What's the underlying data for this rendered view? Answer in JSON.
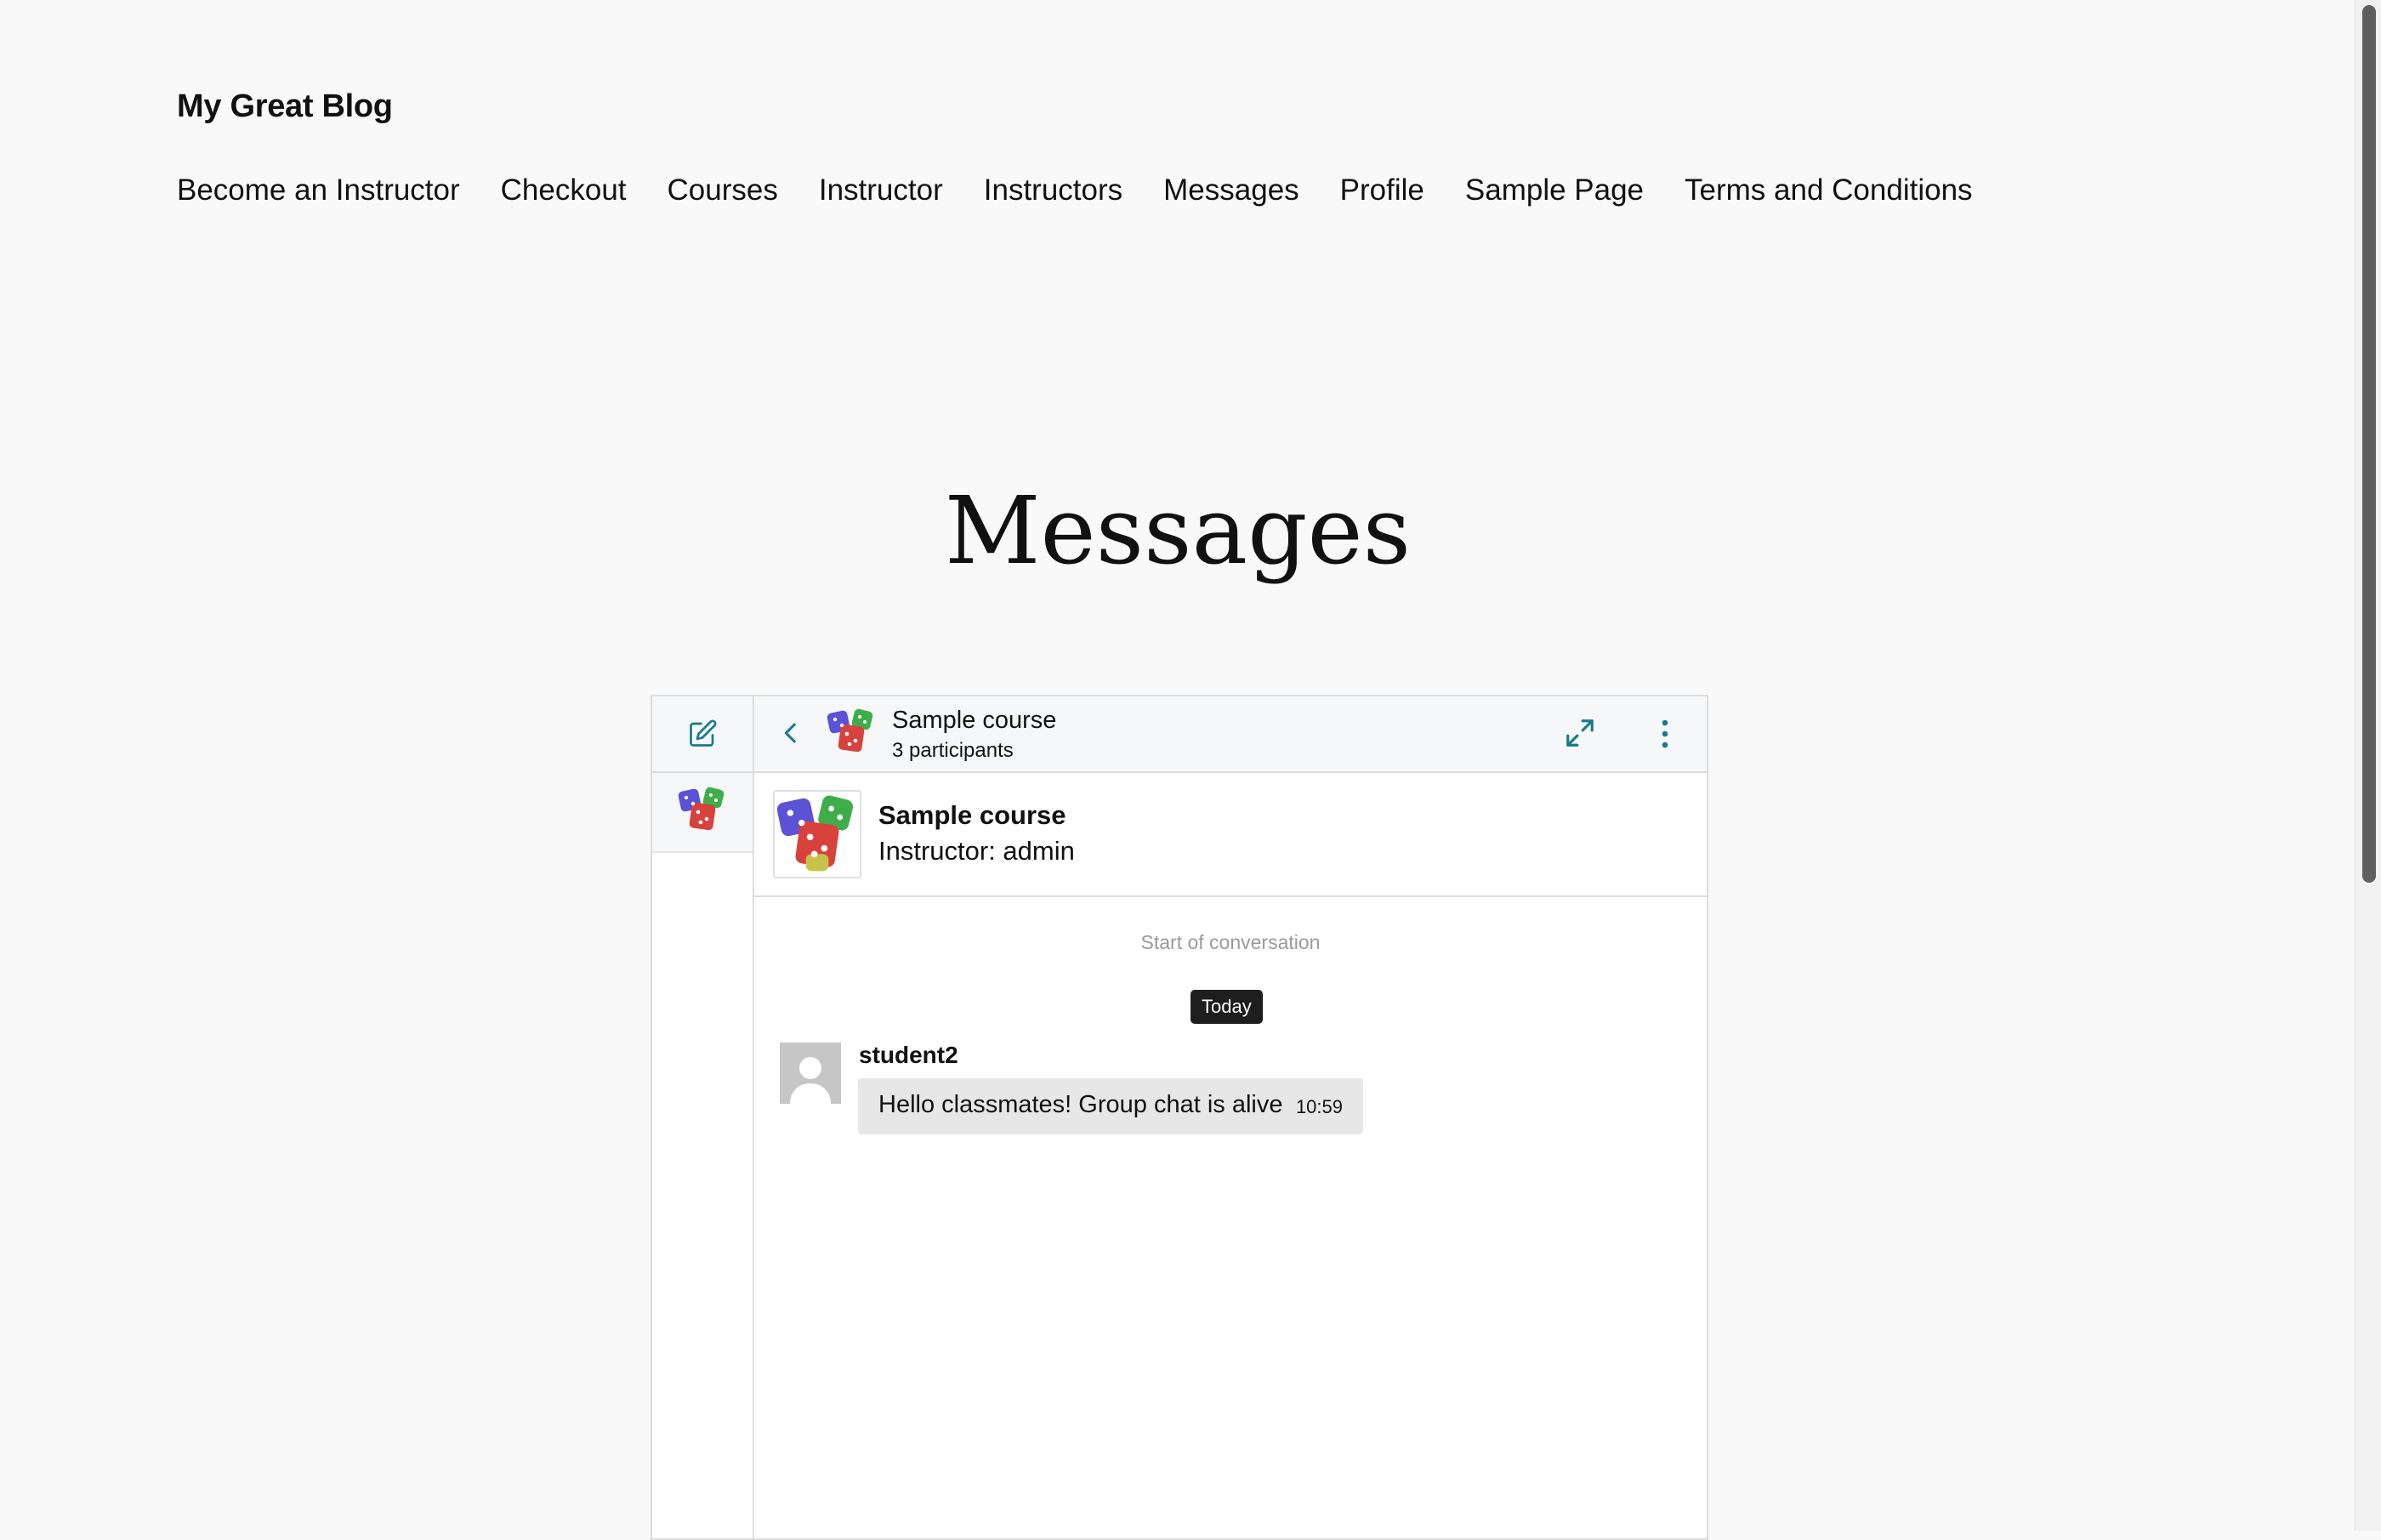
{
  "site": {
    "title": "My Great Blog"
  },
  "nav": {
    "items": [
      "Become an Instructor",
      "Checkout",
      "Courses",
      "Instructor",
      "Instructors",
      "Messages",
      "Profile",
      "Sample Page",
      "Terms and Conditions"
    ]
  },
  "page": {
    "title": "Messages"
  },
  "messaging": {
    "sidebar": {
      "compose_icon": "pencil-square-icon",
      "conversation_icon": "dice-icon"
    },
    "header": {
      "title": "Sample course",
      "participants": "3 participants",
      "back_icon": "chevron-left-icon",
      "expand_icon": "expand-icon",
      "menu_icon": "kebab-menu-icon"
    },
    "course": {
      "name": "Sample course",
      "instructor": "Instructor: admin"
    },
    "conversation": {
      "start_label": "Start of conversation",
      "day_label": "Today",
      "messages": [
        {
          "sender": "student2",
          "text": "Hello classmates! Group chat is alive",
          "time": "10:59"
        }
      ]
    }
  },
  "colors": {
    "accent": "#1a7a8c",
    "background": "#f9f9f9",
    "panel_header": "#f5f7f8",
    "bubble": "#e7e7e7",
    "badge": "#1e1e1e"
  }
}
